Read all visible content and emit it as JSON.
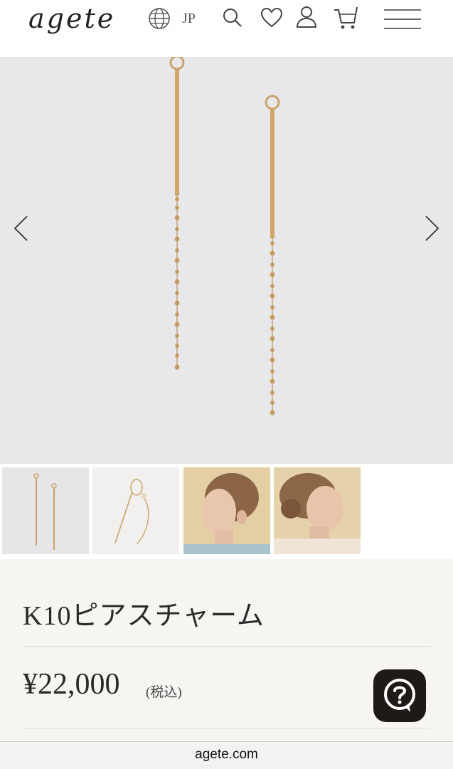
{
  "header": {
    "logo": "agete",
    "language": "JP",
    "icons": [
      "globe-icon",
      "search-icon",
      "heart-icon",
      "user-icon",
      "cart-icon",
      "menu-icon"
    ]
  },
  "gallery": {
    "prev_icon": "chevron-left-icon",
    "next_icon": "chevron-right-icon",
    "thumbnail_count": 4
  },
  "product": {
    "title": "K10ピアスチャーム",
    "price": "¥22,000",
    "tax_note": "(税込)"
  },
  "help": {
    "icon": "question-chat-icon"
  },
  "browser": {
    "url": "agete.com"
  },
  "colors": {
    "gold": "#c9a36b",
    "background": "#f7f5f1",
    "help_button": "#1f1a17"
  }
}
